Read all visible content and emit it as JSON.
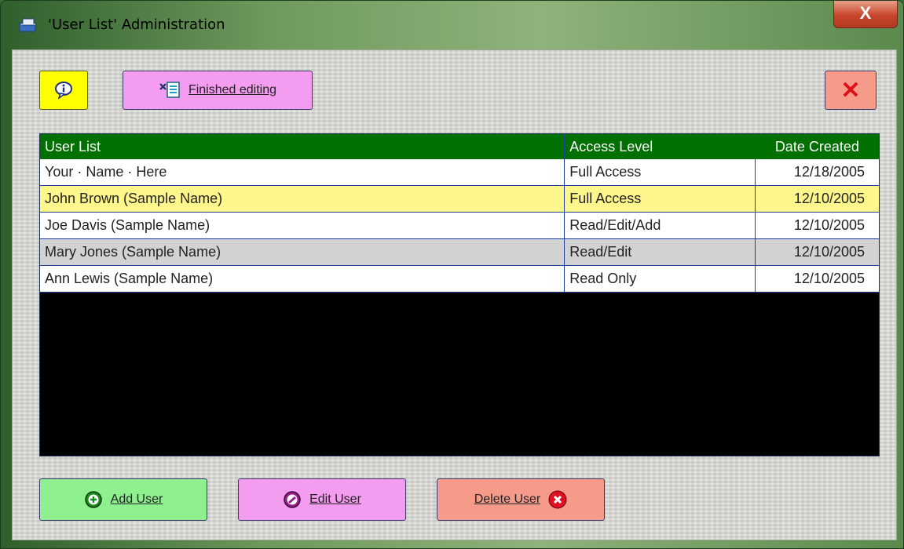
{
  "window": {
    "title": "'User List' Administration",
    "close_glyph": "X"
  },
  "toolbar": {
    "info_icon": "info-bubble-icon",
    "finished_label": "Finished editing",
    "finished_icon": "edit-document-icon",
    "close_glyph": "✕"
  },
  "table": {
    "headers": [
      "User List",
      "Access Level",
      "Date Created"
    ],
    "rows": [
      {
        "name": "Your · Name · Here",
        "access": "Full Access",
        "date": "12/18/2005",
        "style": "white"
      },
      {
        "name": "John Brown (Sample Name)",
        "access": "Full Access",
        "date": "12/10/2005",
        "style": "yellow"
      },
      {
        "name": "Joe Davis (Sample Name)",
        "access": "Read/Edit/Add",
        "date": "12/10/2005",
        "style": "white"
      },
      {
        "name": "Mary Jones (Sample Name)",
        "access": "Read/Edit",
        "date": "12/10/2005",
        "style": "gray"
      },
      {
        "name": "Ann Lewis (Sample Name)",
        "access": "Read Only",
        "date": "12/10/2005",
        "style": "white"
      }
    ]
  },
  "footer": {
    "add_label": "Add User",
    "edit_label": "Edit User",
    "delete_label": "Delete User"
  },
  "colors": {
    "header_green": "#007000",
    "selected_row": "#fdf68a",
    "add_button": "#8ff090",
    "edit_button": "#f49cf0",
    "delete_button": "#f69a8a",
    "info_button": "#ffff00"
  }
}
